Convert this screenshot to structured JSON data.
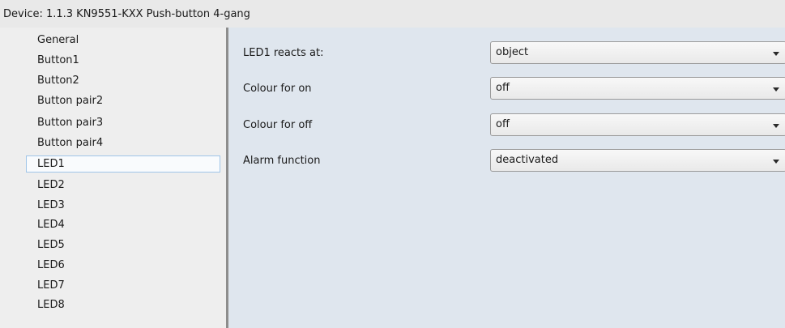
{
  "header": {
    "title": "Device: 1.1.3  KN9551-KXX Push-button 4-gang"
  },
  "sidebar": {
    "items": [
      {
        "label": "General"
      },
      {
        "label": "Button1"
      },
      {
        "label": "Button2"
      },
      {
        "label": "Button pair2"
      },
      {
        "label": "Button pair3"
      },
      {
        "label": "Button pair4"
      },
      {
        "label": "LED1",
        "selected": true
      },
      {
        "label": "LED2"
      },
      {
        "label": "LED3"
      },
      {
        "label": "LED4"
      },
      {
        "label": "LED5"
      },
      {
        "label": "LED6"
      },
      {
        "label": "LED7"
      },
      {
        "label": "LED8"
      }
    ]
  },
  "parameters": [
    {
      "label": "LED1 reacts at:",
      "value": "object"
    },
    {
      "label": "Colour for on",
      "value": "off"
    },
    {
      "label": "Colour for off",
      "value": "off"
    },
    {
      "label": "Alarm function",
      "value": "deactivated"
    }
  ],
  "icons": {
    "dropdown_arrow": "chevron-down-icon"
  }
}
